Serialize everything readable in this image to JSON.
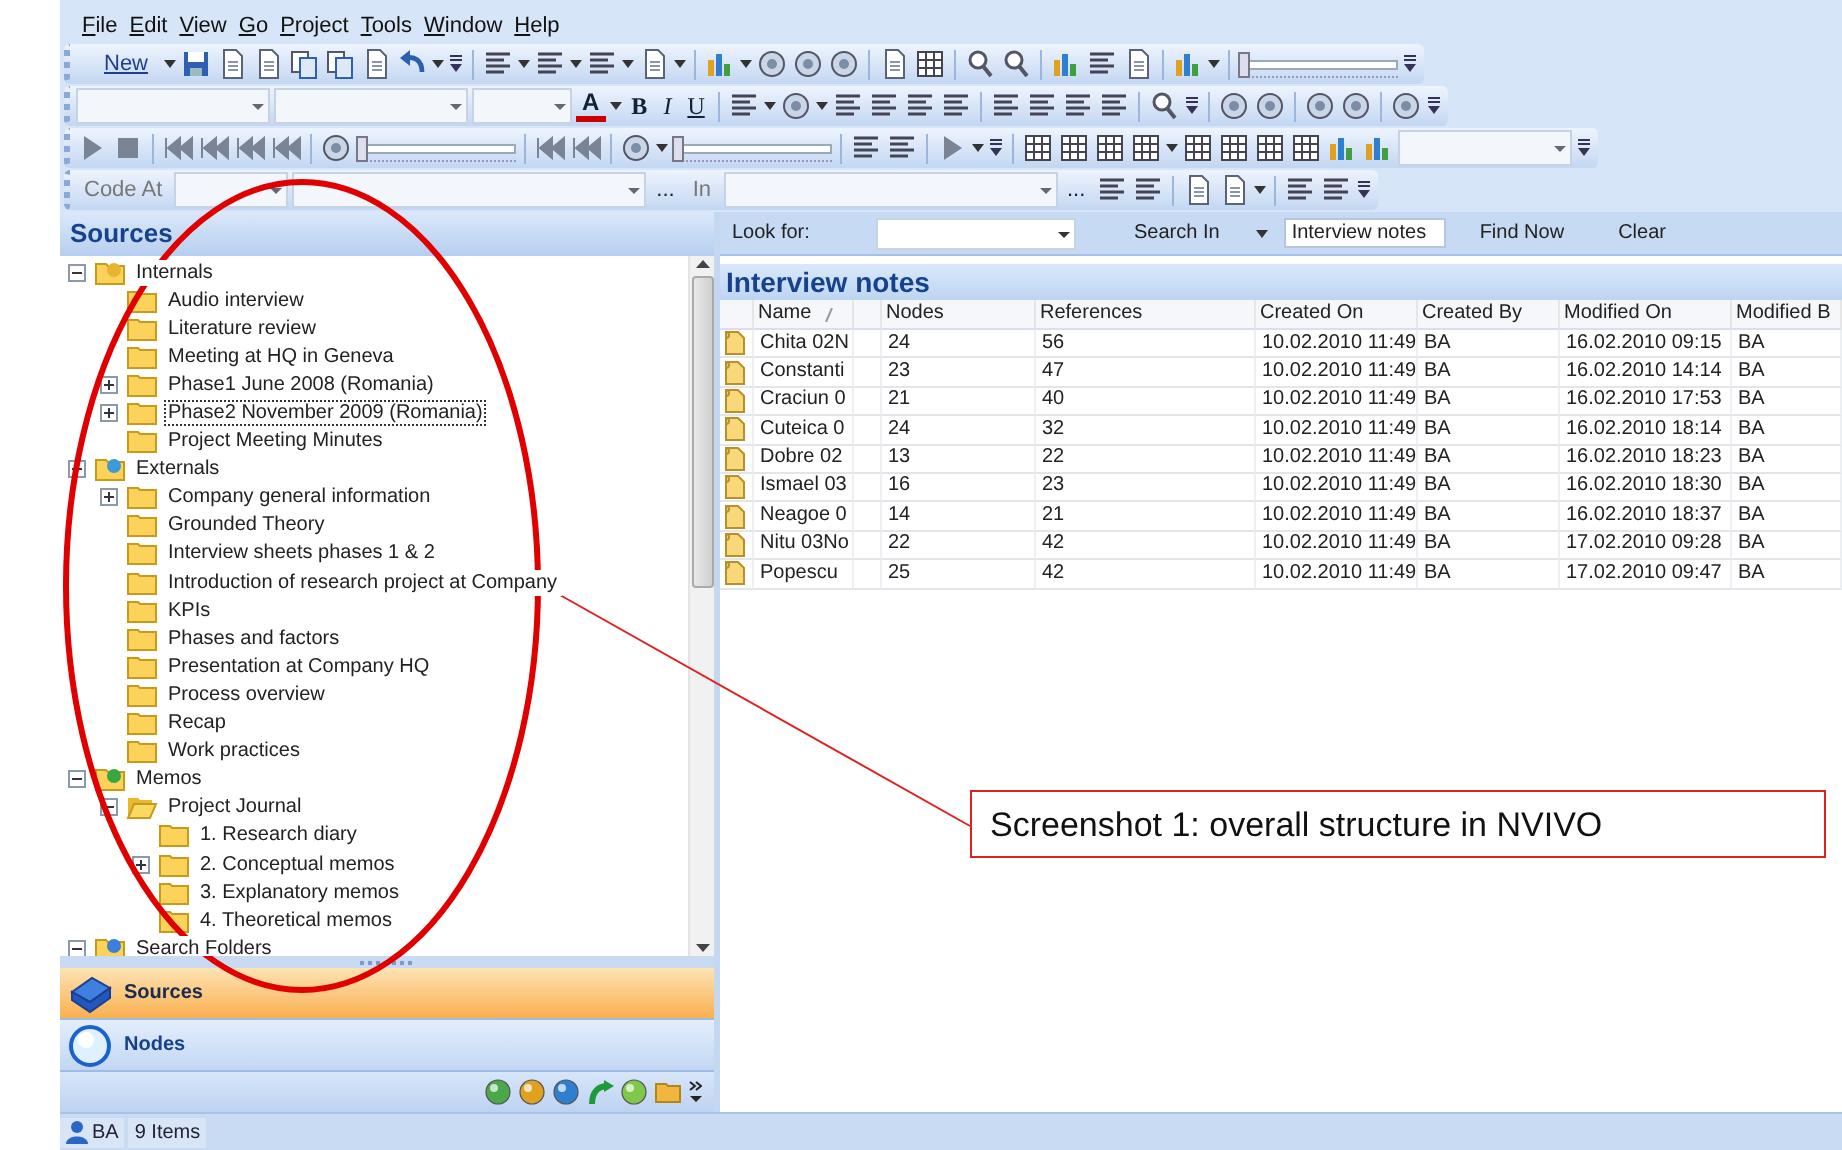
{
  "menu": [
    "File",
    "Edit",
    "View",
    "Go",
    "Project",
    "Tools",
    "Window",
    "Help"
  ],
  "toolbars": [
    {
      "items": [
        {
          "kind": "button",
          "label": "New"
        },
        {
          "kind": "slider",
          "level": 0
        }
      ]
    },
    {
      "items": [
        {
          "kind": "combo"
        },
        {
          "kind": "combo"
        },
        {
          "kind": "combo"
        },
        {
          "kind": "button",
          "label": "A"
        },
        {
          "kind": "button",
          "label": "B"
        },
        {
          "kind": "button",
          "label": "I"
        },
        {
          "kind": "button",
          "label": "U"
        }
      ]
    },
    {
      "items": [
        {
          "kind": "slider",
          "level": 0
        },
        {
          "kind": "slider",
          "level": 0
        },
        {
          "kind": "combo"
        }
      ]
    },
    {
      "items": [
        {
          "kind": "label",
          "label": "Code At"
        },
        {
          "kind": "combo"
        },
        {
          "kind": "combo"
        },
        {
          "kind": "button",
          "label": "..."
        },
        {
          "kind": "label",
          "label": "In"
        },
        {
          "kind": "combo"
        },
        {
          "kind": "button",
          "label": "..."
        }
      ]
    }
  ],
  "sources": {
    "title": "Sources",
    "tree": [
      {
        "label": "Internals",
        "kind": "category",
        "expanded": true,
        "children": [
          {
            "label": "Audio interview"
          },
          {
            "label": "Literature review"
          },
          {
            "label": "Meeting at HQ in Geneva"
          },
          {
            "label": "Phase1 June 2008 (Romania)",
            "expanded": false
          },
          {
            "label": "Phase2 November 2009 (Romania)",
            "expanded": false,
            "focused": true
          },
          {
            "label": "Project Meeting Minutes"
          }
        ]
      },
      {
        "label": "Externals",
        "kind": "category",
        "expanded": true,
        "children": [
          {
            "label": "Company general information",
            "expanded": false
          },
          {
            "label": "Grounded Theory"
          },
          {
            "label": "Interview sheets phases 1 & 2"
          },
          {
            "label": "Introduction of research project at Company"
          },
          {
            "label": "KPIs"
          },
          {
            "label": "Phases and factors"
          },
          {
            "label": "Presentation at Company HQ"
          },
          {
            "label": "Process overview"
          },
          {
            "label": "Recap"
          },
          {
            "label": "Work practices"
          }
        ]
      },
      {
        "label": "Memos",
        "kind": "category",
        "expanded": true,
        "children": [
          {
            "label": "Project Journal",
            "expanded": true,
            "children": [
              {
                "label": "1. Research diary"
              },
              {
                "label": "2. Conceptual memos",
                "expanded": false
              },
              {
                "label": "3. Explanatory memos"
              },
              {
                "label": "4. Theoretical memos"
              }
            ]
          }
        ]
      },
      {
        "label": "Search Folders",
        "kind": "category",
        "expanded": true
      }
    ]
  },
  "navigation": [
    {
      "label": "Sources",
      "selected": true
    },
    {
      "label": "Nodes",
      "selected": false
    }
  ],
  "search_bar": {
    "label": "Look for:",
    "search_in": "Search In",
    "scope": "Interview notes",
    "find": "Find Now",
    "clear": "Clear"
  },
  "table": {
    "title": "Interview notes",
    "columns": [
      {
        "label": "Name",
        "sorted": true
      },
      {
        "label": "Nodes"
      },
      {
        "label": "References"
      },
      {
        "label": "Created On"
      },
      {
        "label": "Created By"
      },
      {
        "label": "Modified On"
      },
      {
        "label": "Modified B"
      }
    ],
    "rows": [
      [
        "Chita 02N",
        "24",
        "56",
        "10.02.2010 11:49",
        "BA",
        "16.02.2010 09:15",
        "BA"
      ],
      [
        "Constanti",
        "23",
        "47",
        "10.02.2010 11:49",
        "BA",
        "16.02.2010 14:14",
        "BA"
      ],
      [
        "Craciun 0",
        "21",
        "40",
        "10.02.2010 11:49",
        "BA",
        "16.02.2010 17:53",
        "BA"
      ],
      [
        "Cuteica 0",
        "24",
        "32",
        "10.02.2010 11:49",
        "BA",
        "16.02.2010 18:14",
        "BA"
      ],
      [
        "Dobre 02",
        "13",
        "22",
        "10.02.2010 11:49",
        "BA",
        "16.02.2010 18:23",
        "BA"
      ],
      [
        "Ismael 03",
        "16",
        "23",
        "10.02.2010 11:49",
        "BA",
        "16.02.2010 18:30",
        "BA"
      ],
      [
        "Neagoe 0",
        "14",
        "21",
        "10.02.2010 11:49",
        "BA",
        "16.02.2010 18:37",
        "BA"
      ],
      [
        "Nitu 03No",
        "22",
        "42",
        "10.02.2010 11:49",
        "BA",
        "17.02.2010 09:28",
        "BA"
      ],
      [
        "Popescu",
        "25",
        "42",
        "10.02.2010 11:49",
        "BA",
        "17.02.2010 09:47",
        "BA"
      ]
    ]
  },
  "status_bar": {
    "user": "BA",
    "count": "9 Items"
  },
  "annotation": {
    "callout": "Screenshot 1: overall structure in NVIVO"
  }
}
